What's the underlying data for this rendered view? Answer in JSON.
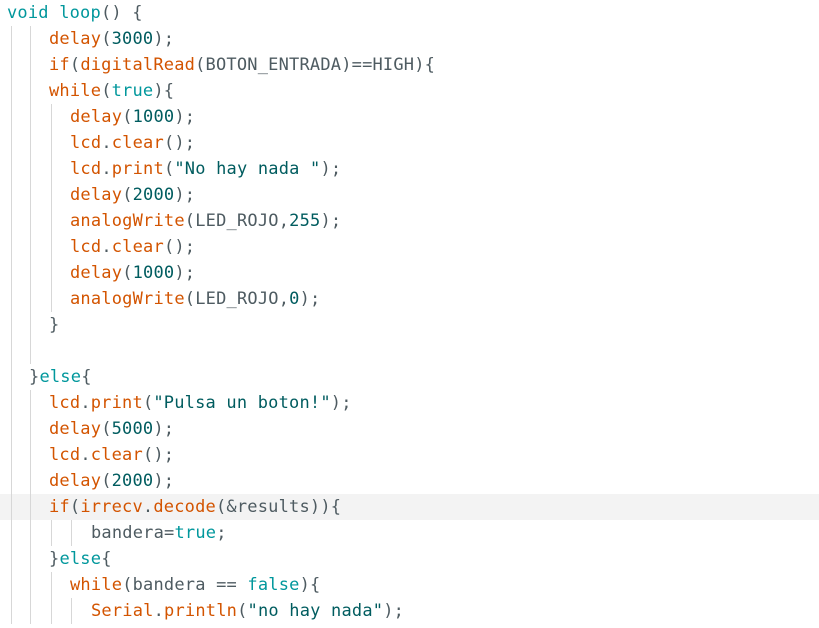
{
  "editor": {
    "language": "arduino",
    "colors": {
      "background": "#ffffff",
      "keyword": "#00979c",
      "function": "#d35400",
      "number_string": "#005c5f",
      "text": "#4e5b61",
      "active_line": "#f3f3f3",
      "indent_guide": "#d7d7d7"
    },
    "active_line_index": 19,
    "lines": [
      {
        "indent": 0,
        "tokens": [
          {
            "t": "void",
            "c": "kw"
          },
          {
            "t": " ",
            "c": "txt"
          },
          {
            "t": "loop",
            "c": "kw"
          },
          {
            "t": "() {",
            "c": "txt"
          }
        ]
      },
      {
        "indent": 2,
        "tokens": [
          {
            "t": "delay",
            "c": "fn"
          },
          {
            "t": "(",
            "c": "txt"
          },
          {
            "t": "3000",
            "c": "num"
          },
          {
            "t": ");",
            "c": "txt"
          }
        ]
      },
      {
        "indent": 2,
        "tokens": [
          {
            "t": "if",
            "c": "fn"
          },
          {
            "t": "(",
            "c": "txt"
          },
          {
            "t": "digitalRead",
            "c": "fn"
          },
          {
            "t": "(BOTON_ENTRADA)==HIGH){",
            "c": "txt"
          }
        ]
      },
      {
        "indent": 2,
        "tokens": [
          {
            "t": "while",
            "c": "fn"
          },
          {
            "t": "(",
            "c": "txt"
          },
          {
            "t": "true",
            "c": "kw"
          },
          {
            "t": "){",
            "c": "txt"
          }
        ]
      },
      {
        "indent": 3,
        "tokens": [
          {
            "t": "delay",
            "c": "fn"
          },
          {
            "t": "(",
            "c": "txt"
          },
          {
            "t": "1000",
            "c": "num"
          },
          {
            "t": ");",
            "c": "txt"
          }
        ]
      },
      {
        "indent": 3,
        "tokens": [
          {
            "t": "lcd",
            "c": "fn"
          },
          {
            "t": ".",
            "c": "txt"
          },
          {
            "t": "clear",
            "c": "fn"
          },
          {
            "t": "();",
            "c": "txt"
          }
        ]
      },
      {
        "indent": 3,
        "tokens": [
          {
            "t": "lcd",
            "c": "fn"
          },
          {
            "t": ".",
            "c": "txt"
          },
          {
            "t": "print",
            "c": "fn"
          },
          {
            "t": "(",
            "c": "txt"
          },
          {
            "t": "\"No hay nada \"",
            "c": "str"
          },
          {
            "t": ");",
            "c": "txt"
          }
        ]
      },
      {
        "indent": 3,
        "tokens": [
          {
            "t": "delay",
            "c": "fn"
          },
          {
            "t": "(",
            "c": "txt"
          },
          {
            "t": "2000",
            "c": "num"
          },
          {
            "t": ");",
            "c": "txt"
          }
        ]
      },
      {
        "indent": 3,
        "tokens": [
          {
            "t": "analogWrite",
            "c": "fn"
          },
          {
            "t": "(LED_ROJO,",
            "c": "txt"
          },
          {
            "t": "255",
            "c": "num"
          },
          {
            "t": ");",
            "c": "txt"
          }
        ]
      },
      {
        "indent": 3,
        "tokens": [
          {
            "t": "lcd",
            "c": "fn"
          },
          {
            "t": ".",
            "c": "txt"
          },
          {
            "t": "clear",
            "c": "fn"
          },
          {
            "t": "();",
            "c": "txt"
          }
        ]
      },
      {
        "indent": 3,
        "tokens": [
          {
            "t": "delay",
            "c": "fn"
          },
          {
            "t": "(",
            "c": "txt"
          },
          {
            "t": "1000",
            "c": "num"
          },
          {
            "t": ");",
            "c": "txt"
          }
        ]
      },
      {
        "indent": 3,
        "tokens": [
          {
            "t": "analogWrite",
            "c": "fn"
          },
          {
            "t": "(LED_ROJO,",
            "c": "txt"
          },
          {
            "t": "0",
            "c": "num"
          },
          {
            "t": ");",
            "c": "txt"
          }
        ]
      },
      {
        "indent": 2,
        "tokens": [
          {
            "t": "}",
            "c": "txt"
          }
        ]
      },
      {
        "indent": 2,
        "tokens": []
      },
      {
        "indent": 1,
        "tokens": [
          {
            "t": "}",
            "c": "txt"
          },
          {
            "t": "else",
            "c": "kw"
          },
          {
            "t": "{",
            "c": "txt"
          }
        ]
      },
      {
        "indent": 2,
        "tokens": [
          {
            "t": "lcd",
            "c": "fn"
          },
          {
            "t": ".",
            "c": "txt"
          },
          {
            "t": "print",
            "c": "fn"
          },
          {
            "t": "(",
            "c": "txt"
          },
          {
            "t": "\"Pulsa un boton!\"",
            "c": "str"
          },
          {
            "t": ");",
            "c": "txt"
          }
        ]
      },
      {
        "indent": 2,
        "tokens": [
          {
            "t": "delay",
            "c": "fn"
          },
          {
            "t": "(",
            "c": "txt"
          },
          {
            "t": "5000",
            "c": "num"
          },
          {
            "t": ");",
            "c": "txt"
          }
        ]
      },
      {
        "indent": 2,
        "tokens": [
          {
            "t": "lcd",
            "c": "fn"
          },
          {
            "t": ".",
            "c": "txt"
          },
          {
            "t": "clear",
            "c": "fn"
          },
          {
            "t": "();",
            "c": "txt"
          }
        ]
      },
      {
        "indent": 2,
        "tokens": [
          {
            "t": "delay",
            "c": "fn"
          },
          {
            "t": "(",
            "c": "txt"
          },
          {
            "t": "2000",
            "c": "num"
          },
          {
            "t": ");",
            "c": "txt"
          }
        ]
      },
      {
        "indent": 2,
        "tokens": [
          {
            "t": "if",
            "c": "fn"
          },
          {
            "t": "(",
            "c": "txt"
          },
          {
            "t": "irrecv",
            "c": "fn"
          },
          {
            "t": ".",
            "c": "txt"
          },
          {
            "t": "decode",
            "c": "fn"
          },
          {
            "t": "(&results)){",
            "c": "txt"
          }
        ]
      },
      {
        "indent": 4,
        "tokens": [
          {
            "t": "bandera=",
            "c": "txt"
          },
          {
            "t": "true",
            "c": "kw"
          },
          {
            "t": ";",
            "c": "txt"
          }
        ]
      },
      {
        "indent": 2,
        "tokens": [
          {
            "t": "}",
            "c": "txt"
          },
          {
            "t": "else",
            "c": "kw"
          },
          {
            "t": "{",
            "c": "txt"
          }
        ]
      },
      {
        "indent": 3,
        "tokens": [
          {
            "t": "while",
            "c": "fn"
          },
          {
            "t": "(bandera == ",
            "c": "txt"
          },
          {
            "t": "false",
            "c": "kw"
          },
          {
            "t": "){",
            "c": "txt"
          }
        ]
      },
      {
        "indent": 4,
        "tokens": [
          {
            "t": "Serial",
            "c": "fn"
          },
          {
            "t": ".",
            "c": "txt"
          },
          {
            "t": "println",
            "c": "fn"
          },
          {
            "t": "(",
            "c": "txt"
          },
          {
            "t": "\"no hay nada\"",
            "c": "str"
          },
          {
            "t": ");",
            "c": "txt"
          }
        ]
      }
    ]
  }
}
